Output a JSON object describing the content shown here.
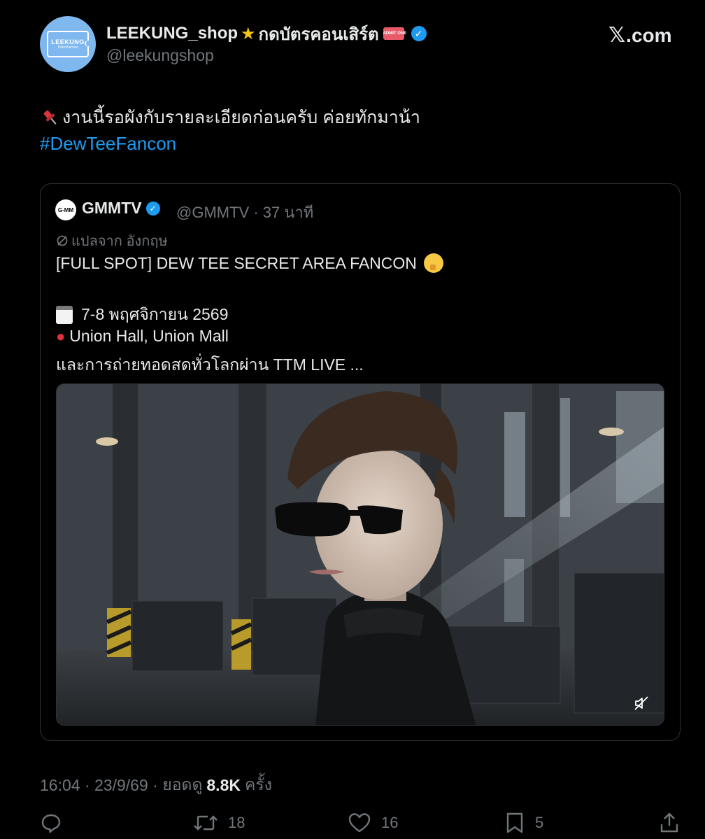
{
  "author": {
    "display_name": "LEEKUNG_shop",
    "display_name_suffix": "กดบัตรคอนเสิร์ต",
    "handle": "@leekungshop",
    "avatar_text_1": "LEEKUNG",
    "avatar_text_2": "TicketService",
    "ticket_emoji_text": "ADMIT ONE"
  },
  "site": {
    "label": ".com"
  },
  "tweet": {
    "text": "งานนี้รอผังกับรายละเอียดก่อนครับ ค่อยทักมาน้า",
    "hashtag": "#DewTeeFancon"
  },
  "quote": {
    "avatar_text": "G-MM",
    "name": "GMMTV",
    "handle": "@GMMTV",
    "separator": "·",
    "time": "37 นาที",
    "translate_label": "แปลจาก อังกฤษ",
    "line1": "[FULL SPOT] DEW TEE SECRET AREA FANCON",
    "line2": "7-8 พฤศจิกายน 2569",
    "line3": "Union Hall, Union Mall",
    "line4": "และการถ่ายทอดสดทั่วโลกผ่าน TTM LIVE ..."
  },
  "footer": {
    "time": "16:04",
    "date": "23/9/69",
    "views_label": "ยอดดู",
    "views_count": "8.8K",
    "views_suffix": "ครั้ง",
    "sep": " · "
  },
  "actions": {
    "retweets": "18",
    "likes": "16",
    "bookmarks": "5"
  },
  "colors": {
    "background": "#000000",
    "text": "#e7e9ea",
    "muted": "#71767b",
    "link": "#1d9bf0",
    "border": "#2f3336"
  },
  "icons": [
    "verified-icon",
    "pin-icon",
    "calendar-icon",
    "location-pin-icon",
    "translate-icon",
    "mute-icon",
    "reply-icon",
    "retweet-icon",
    "like-icon",
    "bookmark-icon",
    "share-icon"
  ]
}
